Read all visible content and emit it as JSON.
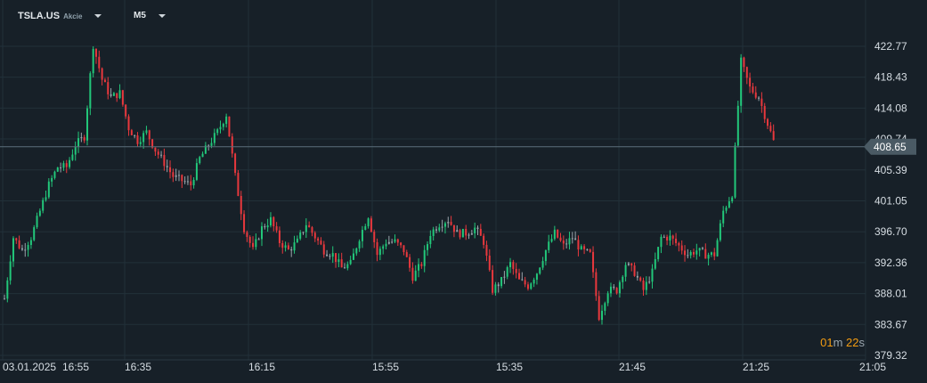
{
  "header": {
    "symbol": "TSLA.US",
    "asset_type": "Akcie",
    "timeframe": "M5"
  },
  "timer": {
    "minutes": "01",
    "m_unit": "m",
    "seconds": "22",
    "s_unit": "s"
  },
  "colors": {
    "background": "#172028",
    "grid": "#223039",
    "up": "#22c77a",
    "down": "#e8383d",
    "neutral": "#9aa4ab",
    "price_line": "#5b6e7a",
    "price_tag": "#4a5a64"
  },
  "chart_data": {
    "type": "candlestick",
    "current_price": "408.65",
    "y_ticks": [
      "422.77",
      "418.43",
      "414.08",
      "409.74",
      "405.39",
      "401.05",
      "396.70",
      "392.36",
      "388.01",
      "383.67",
      "379.32"
    ],
    "ylim": [
      379.32,
      422.77
    ],
    "x_ticks": [
      "03.01.2025",
      "16:55",
      "16:35",
      "16:15",
      "15:55",
      "15:35",
      "21:45",
      "21:25",
      "21:05"
    ],
    "closes": [
      387.3,
      395.9,
      394.1,
      395.9,
      399.6,
      403.3,
      405.8,
      405.8,
      408.9,
      410.1,
      423.0,
      418.1,
      415.6,
      416.2,
      411.3,
      409.5,
      410.7,
      408.2,
      406.4,
      404.5,
      403.9,
      403.3,
      407.0,
      408.9,
      410.7,
      413.2,
      404.5,
      397.2,
      394.1,
      397.2,
      398.4,
      395.3,
      394.1,
      395.3,
      397.8,
      396.0,
      394.1,
      393.5,
      391.6,
      392.2,
      395.9,
      399.0,
      393.5,
      395.3,
      395.3,
      394.1,
      390.4,
      392.2,
      396.5,
      397.8,
      398.4,
      396.5,
      396.5,
      397.2,
      395.3,
      388.5,
      389.8,
      392.2,
      389.8,
      389.1,
      391.0,
      394.1,
      396.5,
      394.7,
      395.9,
      394.1,
      393.5,
      384.8,
      388.5,
      388.5,
      392.2,
      391.0,
      388.5,
      391.0,
      395.9,
      395.9,
      394.7,
      393.5,
      394.1,
      393.5,
      393.5,
      399.6,
      402.1,
      420.6,
      416.9,
      415.6,
      411.9,
      408.2
    ]
  }
}
